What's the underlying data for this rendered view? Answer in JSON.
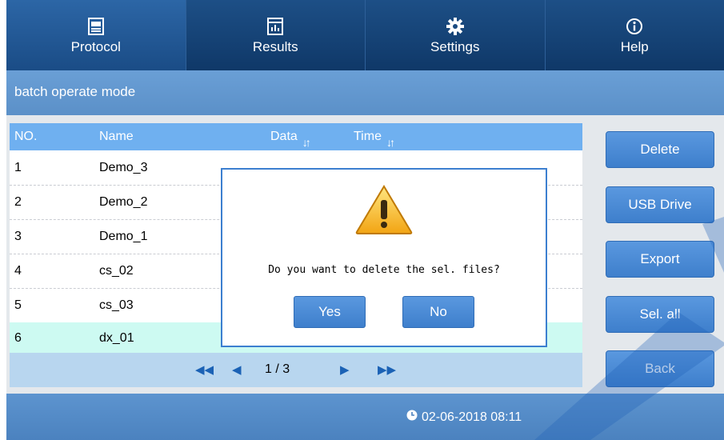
{
  "nav": {
    "tabs": [
      {
        "label": "Protocol",
        "icon": "protocol-icon"
      },
      {
        "label": "Results",
        "icon": "results-icon"
      },
      {
        "label": "Settings",
        "icon": "gear-icon"
      },
      {
        "label": "Help",
        "icon": "info-icon"
      }
    ],
    "active": "Protocol"
  },
  "subtitle": "batch operate mode",
  "table": {
    "columns": [
      "NO.",
      "Name",
      "Data",
      "Time"
    ],
    "rows": [
      {
        "no": "1",
        "name": "Demo_3"
      },
      {
        "no": "2",
        "name": "Demo_2"
      },
      {
        "no": "3",
        "name": "Demo_1"
      },
      {
        "no": "4",
        "name": "cs_02"
      },
      {
        "no": "5",
        "name": "cs_03"
      },
      {
        "no": "6",
        "name": "dx_01"
      }
    ],
    "selected_row": "6"
  },
  "pager": {
    "text": "1 / 3"
  },
  "side_buttons": {
    "delete": "Delete",
    "usb": "USB Drive",
    "export": "Export",
    "select_all": "Sel. all",
    "back": "Back"
  },
  "dialog": {
    "message": "Do you want to delete the sel. files?",
    "yes": "Yes",
    "no": "No"
  },
  "footer": {
    "datetime": "02-06-2018 08:11"
  },
  "colors": {
    "nav_bg": "#1d4f86",
    "header_bg": "#6fb0f0",
    "button": "#4a8ad6",
    "selected_row": "#cdfaf2",
    "watermark": "#1f5fb8"
  }
}
